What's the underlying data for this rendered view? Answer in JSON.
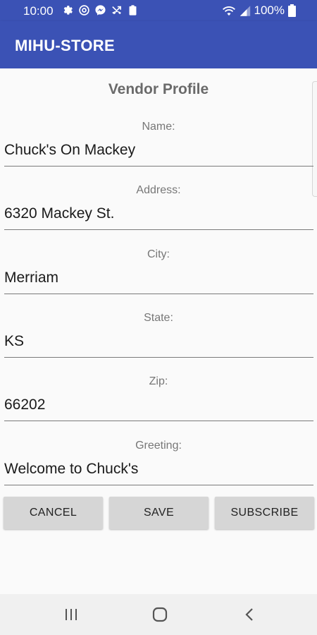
{
  "status_bar": {
    "time": "10:00",
    "battery": "100%",
    "notification_icons": [
      "settings-gear-icon",
      "at-sign-icon",
      "messenger-icon",
      "missed-call-icon",
      "clipboard-icon"
    ],
    "system_icons": [
      "wifi-icon",
      "signal-icon",
      "battery-icon"
    ]
  },
  "app_bar": {
    "title": "MIHU-STORE"
  },
  "page": {
    "heading": "Vendor Profile"
  },
  "form": {
    "fields": [
      {
        "label": "Name:",
        "value": "Chuck's On Mackey"
      },
      {
        "label": "Address:",
        "value": "6320 Mackey St."
      },
      {
        "label": "City:",
        "value": "Merriam"
      },
      {
        "label": "State:",
        "value": "KS"
      },
      {
        "label": "Zip:",
        "value": "66202"
      },
      {
        "label": "Greeting:",
        "value": "Welcome to Chuck's"
      }
    ]
  },
  "actions": {
    "cancel_label": "CANCEL",
    "save_label": "SAVE",
    "subscribe_label": "SUBSCRIBE"
  },
  "nav_bar": {
    "icons": [
      "recent-apps-icon",
      "home-icon",
      "back-icon"
    ]
  },
  "colors": {
    "primary": "#3b52b5",
    "button_bg": "#d6d6d6",
    "background": "#fafafa"
  }
}
